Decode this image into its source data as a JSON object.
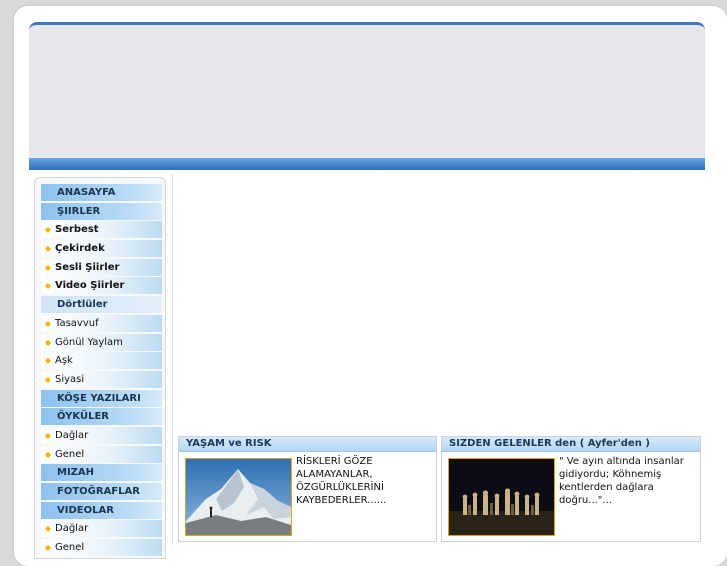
{
  "menu": {
    "items": [
      {
        "label": "ANASAYFA",
        "kind": "cat"
      },
      {
        "label": "ŞIIRLER",
        "kind": "cat"
      },
      {
        "label": "Serbest",
        "kind": "sub"
      },
      {
        "label": "Çekirdek",
        "kind": "sub"
      },
      {
        "label": "Sesli Şiirler",
        "kind": "sub"
      },
      {
        "label": "Video Şiirler",
        "kind": "sub"
      },
      {
        "label": "Dörtlüler",
        "kind": "cat-light"
      },
      {
        "label": "Tasavvuf",
        "kind": "sub-light"
      },
      {
        "label": "Gönül Yaylam",
        "kind": "sub-light"
      },
      {
        "label": "Aşk",
        "kind": "sub-light"
      },
      {
        "label": "Siyasi",
        "kind": "sub-light"
      },
      {
        "label": "KÖŞE YAZILARI",
        "kind": "cat"
      },
      {
        "label": "ÖYKÜLER",
        "kind": "cat"
      },
      {
        "label": "Dağlar",
        "kind": "sub-light"
      },
      {
        "label": "Genel",
        "kind": "sub-light"
      },
      {
        "label": "MIZAH",
        "kind": "cat"
      },
      {
        "label": "FOTOĞRAFLAR",
        "kind": "cat"
      },
      {
        "label": "VIDEOLAR",
        "kind": "cat"
      },
      {
        "label": "Dağlar",
        "kind": "sub-light"
      },
      {
        "label": "Genel",
        "kind": "sub-light"
      }
    ]
  },
  "articles": [
    {
      "title": "YAŞAM ve RISK",
      "text": "RİSKLERİ GÖZE ALAMAYANLAR, ÖZGÜRLÜKLERİNİ KAYBEDERLER......",
      "image": "mountain-photo"
    },
    {
      "title": "SIZDEN GELENLER den ( Ayfer'den )",
      "text": "\" Ve ayın altında insanlar gidiyordu; Köhnemiş kentlerden dağlara doğru...\"...",
      "image": "night-group-photo"
    }
  ],
  "colors": {
    "accent": "#3d78c4",
    "menu_cat": "#8dc1ee",
    "bullet": "#f5b400",
    "thumb_border": "#e0a020"
  }
}
